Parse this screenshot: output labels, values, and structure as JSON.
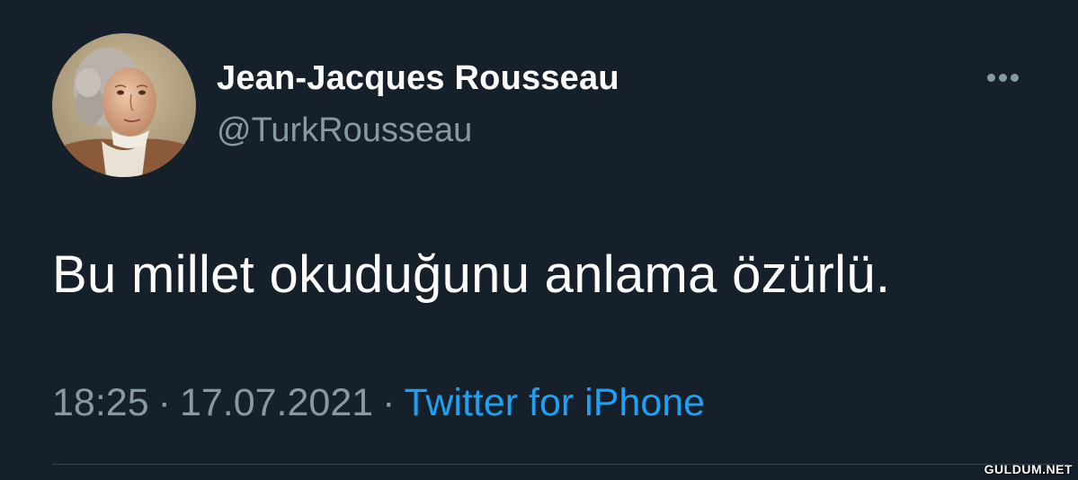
{
  "tweet": {
    "display_name": "Jean-Jacques Rousseau",
    "handle": "@TurkRousseau",
    "text": "Bu millet okuduğunu anlama özürlü.",
    "time": "18:25",
    "separator": "·",
    "date": "17.07.2021",
    "source": "Twitter for iPhone",
    "more_icon": "more-horizontal-icon"
  },
  "watermark": "GULDUM.NET",
  "colors": {
    "background": "#15202b",
    "text_primary": "#ffffff",
    "text_secondary": "#8899a6",
    "accent": "#1da1f2",
    "divider": "#38444d"
  }
}
